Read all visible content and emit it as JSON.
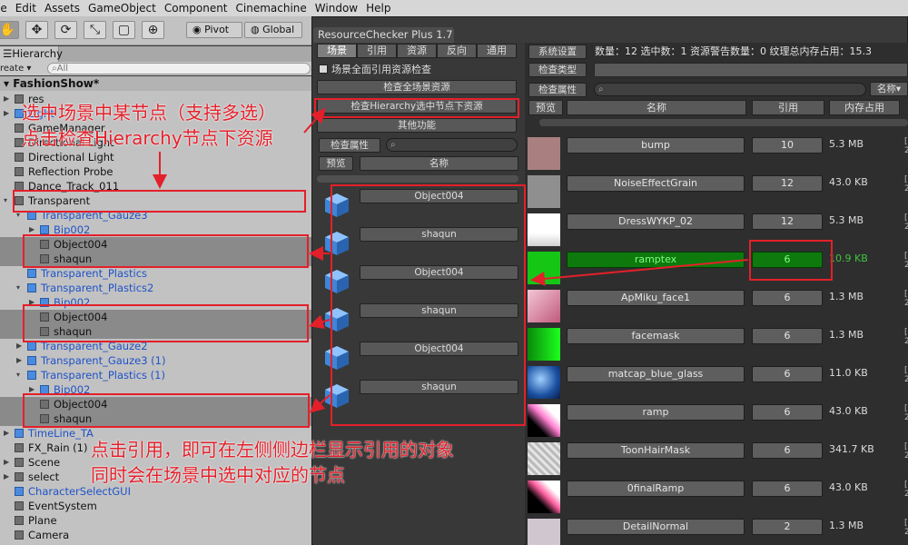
{
  "menu": [
    "le",
    "Edit",
    "Assets",
    "GameObject",
    "Component",
    "Cinemachine",
    "Window",
    "Help"
  ],
  "toolbar": {
    "pivot_label": "Pivot",
    "global_label": "Global"
  },
  "hierarchy": {
    "tab_label": "Hierarchy",
    "create_label": "reate",
    "search_placeholder": "All",
    "scene_name": "FashionShow*",
    "rows": [
      {
        "label": "res"
      },
      {
        "label": "Light"
      },
      {
        "label": "GameManager"
      },
      {
        "label": "Directional Light"
      },
      {
        "label": "Directional Light"
      },
      {
        "label": "Reflection Probe"
      },
      {
        "label": "Dance_Track_011"
      },
      {
        "label": "Transparent"
      },
      {
        "label": "Transparent_Gauze3"
      },
      {
        "label": "Bip002"
      },
      {
        "label": "Object004"
      },
      {
        "label": "shaqun"
      },
      {
        "label": "Transparent_Plastics"
      },
      {
        "label": "Transparent_Plastics2"
      },
      {
        "label": "Bip002"
      },
      {
        "label": "Object004"
      },
      {
        "label": "shaqun"
      },
      {
        "label": "Transparent_Gauze2"
      },
      {
        "label": "Transparent_Gauze3 (1)"
      },
      {
        "label": "Transparent_Plastics (1)"
      },
      {
        "label": "Bip002"
      },
      {
        "label": "Object004"
      },
      {
        "label": "shaqun"
      },
      {
        "label": "TimeLine_TA"
      },
      {
        "label": "FX_Rain (1)"
      },
      {
        "label": "Scene"
      },
      {
        "label": "select"
      },
      {
        "label": "CharacterSelectGUI"
      },
      {
        "label": "EventSystem"
      },
      {
        "label": "Plane"
      },
      {
        "label": "Camera"
      }
    ]
  },
  "checker": {
    "title": "ResourceChecker Plus 1.7",
    "tabs": [
      "场景",
      "引用",
      "资源",
      "反向",
      "通用"
    ],
    "toggle_label": "场景全面引用资源检查",
    "btn_check_all": "检查全场景资源",
    "btn_check_hierarchy": "检查Hierarchy选中节点下资源",
    "btn_other": "其他功能",
    "btn_check_prop": "检查属性",
    "btn_preview": "预览",
    "col_name": "名称",
    "left_items": [
      "Object004",
      "shaqun",
      "Object004",
      "shaqun",
      "Object004",
      "shaqun"
    ]
  },
  "status": {
    "settings_btn": "系统设置",
    "text": "数量：12  选中数：1  资源警告数量：0  纹理总内存占用：15.3"
  },
  "right": {
    "check_type_label": "检查类型",
    "check_prop_label": "检查属性",
    "search_dropdown": "名称",
    "headers": {
      "preview": "预览",
      "name": "名称",
      "ref": "引用",
      "mem": "内存占用"
    },
    "rows": [
      {
        "name": "bump",
        "count": "10",
        "size": "5.3 MB"
      },
      {
        "name": "NoiseEffectGrain",
        "count": "12",
        "size": "43.0 KB"
      },
      {
        "name": "DressWYKP_02",
        "count": "12",
        "size": "5.3 MB"
      },
      {
        "name": "ramptex",
        "count": "6",
        "size": "10.9 KB"
      },
      {
        "name": "ApMiku_face1",
        "count": "6",
        "size": "1.3 MB"
      },
      {
        "name": "facemask",
        "count": "6",
        "size": "1.3 MB"
      },
      {
        "name": "matcap_blue_glass",
        "count": "6",
        "size": "11.0 KB"
      },
      {
        "name": "ramp",
        "count": "6",
        "size": "43.0 KB"
      },
      {
        "name": "ToonHairMask",
        "count": "6",
        "size": "341.7 KB"
      },
      {
        "name": "0finalRamp",
        "count": "6",
        "size": "43.0 KB"
      },
      {
        "name": "DetailNormal",
        "count": "2",
        "size": "1.3 MB"
      }
    ]
  },
  "annotations": {
    "top_line1": "选中场景中某节点（支持多选）",
    "top_line2": "点击检查Hierarchy节点下资源",
    "bottom_line1": "点击引用，即可在左侧侧边栏显示引用的对象",
    "bottom_line2": "同时会在场景中选中对应的节点"
  },
  "colors": {
    "annotation": "#e3202a",
    "highlight_green": "#0e7a0e",
    "link_blue": "#1f53c8"
  }
}
